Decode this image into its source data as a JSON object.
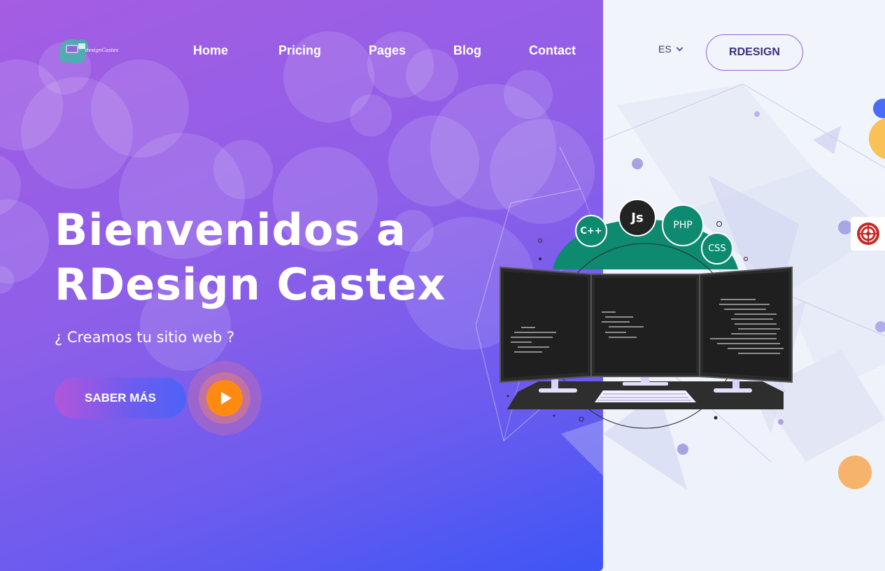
{
  "nav": {
    "logo_alt": "RDesign Castex",
    "items": [
      {
        "label": "Home"
      },
      {
        "label": "Pricing"
      },
      {
        "label": "Pages"
      },
      {
        "label": "Blog"
      },
      {
        "label": "Contact"
      }
    ],
    "language": "ES",
    "cta_label": "RDESIGN"
  },
  "hero": {
    "title_line1": "Bienvenidos a",
    "title_line2": "RDesign Castex",
    "subtitle": "¿ Creamos tu sitio web ?",
    "primary_button": "SABER MÁS",
    "play_icon": "play-icon"
  },
  "illustration": {
    "badges": [
      "C++",
      "Js",
      "PHP",
      "CSS"
    ]
  },
  "colors": {
    "gradient_start": "#a45de3",
    "gradient_end": "#3d56f5",
    "play_orange": "#ff8a12",
    "badge_green": "#0e8a70",
    "badge_dark": "#232323",
    "accent_outline": "#9b5fd8"
  }
}
